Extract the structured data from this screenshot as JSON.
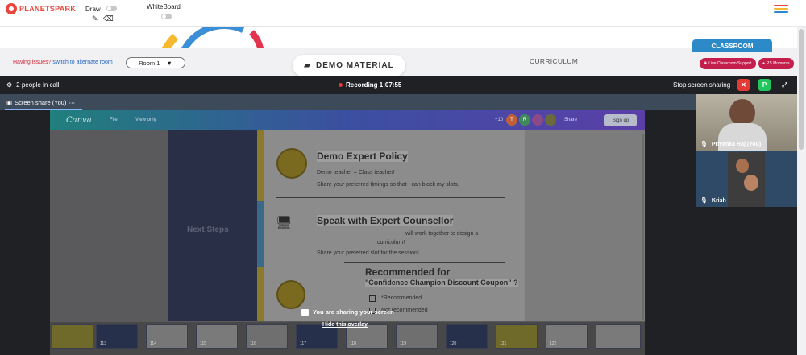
{
  "app": {
    "brand": "PLANETSPARK"
  },
  "toolbar": {
    "draw_label": "Draw",
    "whiteboard_label": "WhiteBoard",
    "menu_colors": [
      "#e8463a",
      "#f5b82e",
      "#2d8ac9"
    ]
  },
  "infobar": {
    "issues_text": "Having issues?",
    "switch_link": "switch to alternate room",
    "room_selected": "Room 1",
    "demo_material": "DEMO MATERIAL",
    "curriculum": "CURRICULUM",
    "classroom_tab": "CLASSROOM",
    "live_support": "Live Classroom Support",
    "ps_moments": "PS Moments"
  },
  "meet": {
    "people_count": "2 people in call",
    "recording": "Recording 1:07:55",
    "stop_share": "Stop screen sharing",
    "screen_share_label": "Screen share (You)",
    "overlay_message": "You are sharing your screen",
    "hide_overlay": "Hide this overlay",
    "participants": [
      {
        "name": "Priyanka Raj (You)"
      },
      {
        "name": "Krish"
      }
    ]
  },
  "canva": {
    "logo": "Canva",
    "file": "File",
    "view_only": "View only",
    "collab_count": "+10",
    "avatar_letters": [
      "T",
      "R"
    ],
    "share": "Share",
    "sign_up": "Sign up"
  },
  "slide": {
    "nav_text": "Next Steps",
    "h1": "Demo Expert Policy",
    "p1": "Demo teacher = Class teacher!",
    "p2": "Share your preferred timings so that I can block my slots.",
    "h2": "Speak with Expert Counsellor",
    "p3": "will work together to design a",
    "p4": "curriculum!",
    "p5": "Share your preferred slot for the session!",
    "h3": "Recommended for",
    "h4": "\"Confidence Champion Discount Coupon\" ?",
    "opt1": "*Recommended",
    "opt2": "Not recommended"
  },
  "thumbnails": [
    "113",
    "114",
    "115",
    "116",
    "117",
    "118",
    "119",
    "120",
    "121",
    "122"
  ]
}
